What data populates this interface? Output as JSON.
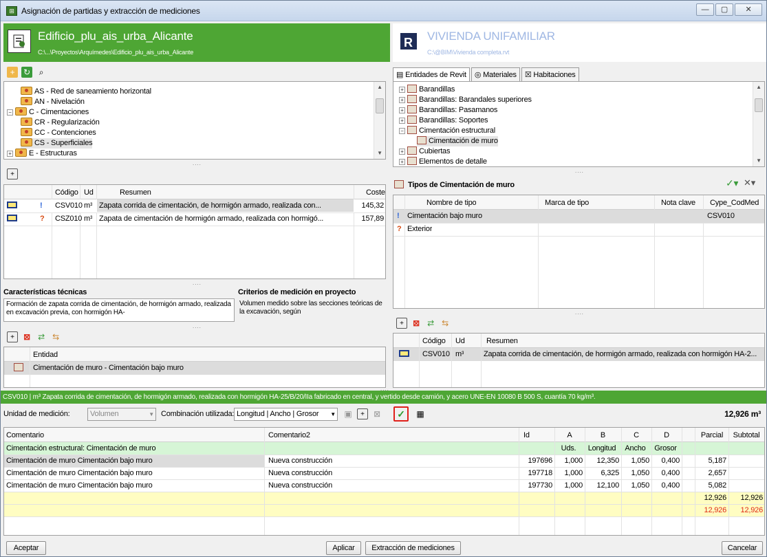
{
  "window": {
    "title": "Asignación de partidas y extracción de mediciones",
    "min_label": "—",
    "max_label": "▢",
    "close_label": "✕"
  },
  "left_header": {
    "title": "Edificio_plu_ais_urba_Alicante",
    "path": "C:\\...\\Proyectos\\Arquímedes\\Edificio_plu_ais_urba_Alicante",
    "logo": "document-icon"
  },
  "right_header": {
    "title": "VIVIENDA UNIFAMILIAR",
    "path": "C:\\@BIM\\Vivienda completa.rvt",
    "logo": "revit-icon"
  },
  "left_tree": [
    "AS - Red de saneamiento horizontal",
    "AN - Nivelación",
    "C - Cimentaciones",
    "CR - Regularización",
    "CC - Contenciones",
    "CS - Superficiales",
    "E - Estructuras"
  ],
  "right_tabs": [
    "Entidades de Revit",
    "Materiales",
    "Habitaciones"
  ],
  "right_tree": [
    "Barandillas",
    "Barandillas: Barandales superiores",
    "Barandillas: Pasamanos",
    "Barandillas: Soportes",
    "Cimentación estructural",
    "Cimentación de muro",
    "Cubiertas",
    "Elementos de detalle"
  ],
  "partidas": {
    "headers": {
      "codigo": "Código",
      "ud": "Ud",
      "resumen": "Resumen",
      "coste": "Coste"
    },
    "rows": [
      {
        "codigo": "CSV010",
        "ud": "m³",
        "resumen": "Zapata corrida de cimentación, de hormigón armado, realizada con...",
        "coste": "145,32",
        "flag": "!"
      },
      {
        "codigo": "CSZ010",
        "ud": "m³",
        "resumen": "Zapata de cimentación de hormigón armado, realizada con hormigó...",
        "coste": "157,89",
        "flag": "?"
      }
    ]
  },
  "caracteristicas": {
    "title": "Características técnicas",
    "text": "Formación de zapata corrida de cimentación, de hormigón armado, realizada en excavación previa, con hormigón HA-"
  },
  "criterios": {
    "title": "Criterios de medición en proyecto",
    "text": "Volumen medido sobre las secciones teóricas de la excavación, según"
  },
  "tipos": {
    "title": "Tipos de Cimentación de muro",
    "headers": {
      "nombre": "Nombre de tipo",
      "marca": "Marca de tipo",
      "nota": "Nota clave",
      "cype": "Cype_CodMed"
    },
    "rows": [
      {
        "nombre": "Cimentación bajo muro",
        "marca": "",
        "nota": "",
        "cype": "CSV010",
        "flag": "!"
      },
      {
        "nombre": "Exterior",
        "marca": "",
        "nota": "",
        "cype": "",
        "flag": "?"
      }
    ]
  },
  "entidades": {
    "header": "Entidad",
    "rows": [
      "Cimentación de muro - Cimentación bajo muro"
    ]
  },
  "asignadas": {
    "headers": {
      "codigo": "Código",
      "ud": "Ud",
      "resumen": "Resumen"
    },
    "rows": [
      {
        "codigo": "CSV010",
        "ud": "m³",
        "resumen": "Zapata corrida de cimentación, de hormigón armado, realizada con hormigón HA-2..."
      }
    ]
  },
  "status": "CSV010 | m³ Zapata corrida de cimentación, de hormigón armado, realizada con hormigón HA-25/B/20/IIa fabricado en central, y vertido desde camión, y acero UNE-EN 10080 B 500 S, cuantía 70 kg/m³.",
  "medicion": {
    "unidad_label": "Unidad de medición:",
    "unidad_value": "Volumen",
    "combinacion_label": "Combinación utilizada:",
    "combinacion_value": "Longitud | Ancho | Grosor",
    "total": "12,926 m³"
  },
  "lines": {
    "headers": {
      "comentario": "Comentario",
      "comentario2": "Comentario2",
      "id": "Id",
      "a": "A",
      "b": "B",
      "c": "C",
      "d": "D",
      "parcial": "Parcial",
      "subtotal": "Subtotal"
    },
    "rows": [
      {
        "comentario": "Cimentación estructural: Cimentación de muro",
        "comentario2": "",
        "id": "",
        "a": "Uds.",
        "b": "Longitud",
        "c": "Ancho",
        "d": "Grosor",
        "parcial": "",
        "subtotal": ""
      },
      {
        "comentario": "Cimentación de muro Cimentación bajo muro",
        "comentario2": "Nueva construcción",
        "id": "197696",
        "a": "1,000",
        "b": "12,350",
        "c": "1,050",
        "d": "0,400",
        "parcial": "5,187",
        "subtotal": ""
      },
      {
        "comentario": "Cimentación de muro Cimentación bajo muro",
        "comentario2": "Nueva construcción",
        "id": "197718",
        "a": "1,000",
        "b": "6,325",
        "c": "1,050",
        "d": "0,400",
        "parcial": "2,657",
        "subtotal": ""
      },
      {
        "comentario": "Cimentación de muro Cimentación bajo muro",
        "comentario2": "Nueva construcción",
        "id": "197730",
        "a": "1,000",
        "b": "12,100",
        "c": "1,050",
        "d": "0,400",
        "parcial": "5,082",
        "subtotal": ""
      },
      {
        "comentario": "",
        "comentario2": "",
        "id": "",
        "a": "",
        "b": "",
        "c": "",
        "d": "",
        "parcial": "12,926",
        "subtotal": "12,926"
      },
      {
        "comentario": "",
        "comentario2": "",
        "id": "",
        "a": "",
        "b": "",
        "c": "",
        "d": "",
        "parcial": "12,926",
        "subtotal": "12,926"
      }
    ]
  },
  "buttons": {
    "aceptar": "Aceptar",
    "aplicar": "Aplicar",
    "extraccion": "Extracción de mediciones",
    "cancelar": "Cancelar"
  },
  "colors": {
    "green": "#4ea634",
    "blue": "#3264b8",
    "red": "#e02a15"
  }
}
